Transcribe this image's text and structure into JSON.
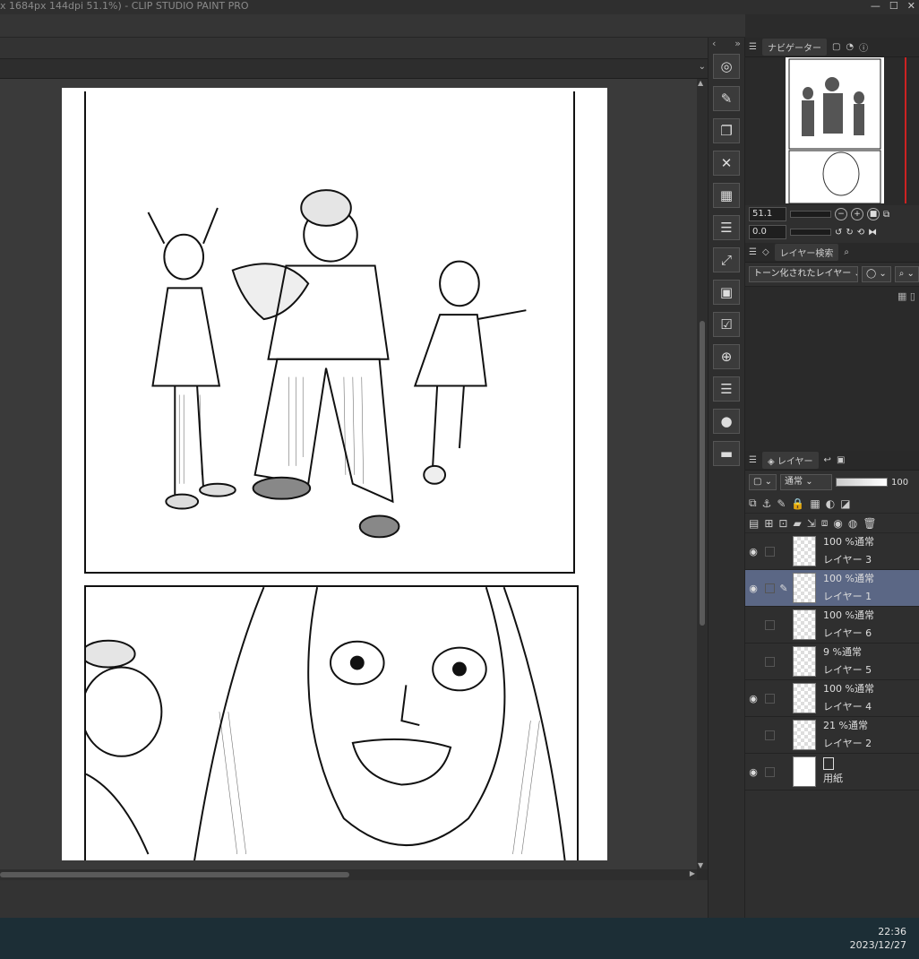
{
  "window": {
    "title": "x 1684px 144dpi 51.1%) - CLIP STUDIO PAINT PRO",
    "minimize": "—",
    "maximize": "☐",
    "close": "✕"
  },
  "toolbar": {
    "collapse_left": "‹",
    "expand": "»",
    "tools": [
      {
        "name": "zoom-reset-icon",
        "glyph": "◎"
      },
      {
        "name": "edit-icon",
        "glyph": "✎"
      },
      {
        "name": "copy-icon",
        "glyph": "❐"
      },
      {
        "name": "delete-icon",
        "glyph": "✕"
      },
      {
        "name": "tone-icon",
        "glyph": "▦"
      },
      {
        "name": "document-icon",
        "glyph": "☰"
      },
      {
        "name": "transform-icon",
        "glyph": "⤢"
      },
      {
        "name": "folder-icon",
        "glyph": "▣"
      },
      {
        "name": "check-icon",
        "glyph": "☑"
      },
      {
        "name": "target-icon",
        "glyph": "⊕"
      },
      {
        "name": "list-icon",
        "glyph": "☰"
      },
      {
        "name": "drop-icon",
        "glyph": "●"
      },
      {
        "name": "panel-icon",
        "glyph": "▬"
      }
    ]
  },
  "navigator": {
    "tab_label": "ナビゲーター",
    "zoom_value": "51.1",
    "rotate_value": "0.0"
  },
  "layer_search": {
    "tab_label": "レイヤー検索",
    "filter_value": "トーン化されたレイヤー"
  },
  "layers": {
    "tab_label": "レイヤー",
    "blend_mode": "通常",
    "opacity": "100",
    "items": [
      {
        "opacity_mode": "100 %通常",
        "name": "レイヤー 3",
        "visible": true,
        "selected": false
      },
      {
        "opacity_mode": "100 %通常",
        "name": "レイヤー 1",
        "visible": true,
        "selected": true
      },
      {
        "opacity_mode": "100 %通常",
        "name": "レイヤー 6",
        "visible": false,
        "selected": false
      },
      {
        "opacity_mode": "9 %通常",
        "name": "レイヤー 5",
        "visible": false,
        "selected": false
      },
      {
        "opacity_mode": "100 %通常",
        "name": "レイヤー 4",
        "visible": true,
        "selected": false
      },
      {
        "opacity_mode": "21 %通常",
        "name": "レイヤー 2",
        "visible": false,
        "selected": false
      },
      {
        "opacity_mode": "",
        "name": "用紙",
        "visible": true,
        "selected": false
      }
    ]
  },
  "taskbar": {
    "time": "22:36",
    "date": "2023/12/27"
  },
  "icons": {
    "eye": "👁",
    "pen": "✎",
    "chevron": "⌄"
  }
}
